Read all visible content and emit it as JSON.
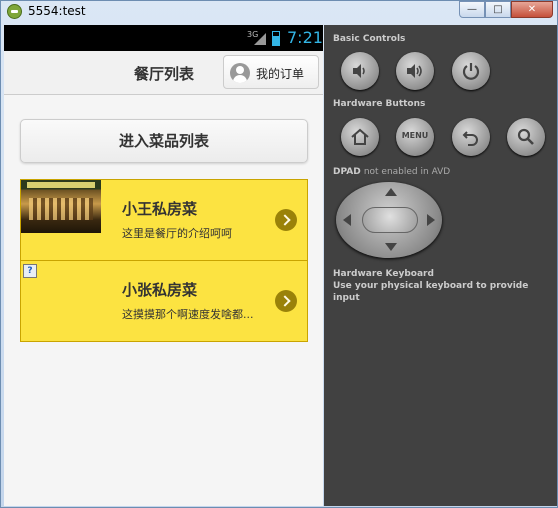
{
  "window": {
    "title": "5554:test"
  },
  "statusbar": {
    "network": "3G",
    "time": "7:21"
  },
  "header": {
    "title": "餐厅列表",
    "order_button": "我的订单"
  },
  "main": {
    "menu_button": "进入菜品列表"
  },
  "restaurants": [
    {
      "name": "小王私房菜",
      "desc": "这里是餐厅的介绍呵呵"
    },
    {
      "name": "小张私房菜",
      "desc": "这摸摸那个啊速度发啥都..."
    }
  ],
  "controls": {
    "basic_controls": "Basic Controls",
    "hardware_buttons": "Hardware Buttons",
    "menu_label": "MENU",
    "dpad_label": "DPAD",
    "dpad_note": "not enabled in AVD",
    "keyboard_title": "Hardware Keyboard",
    "keyboard_note": "Use your physical keyboard to provide input"
  }
}
